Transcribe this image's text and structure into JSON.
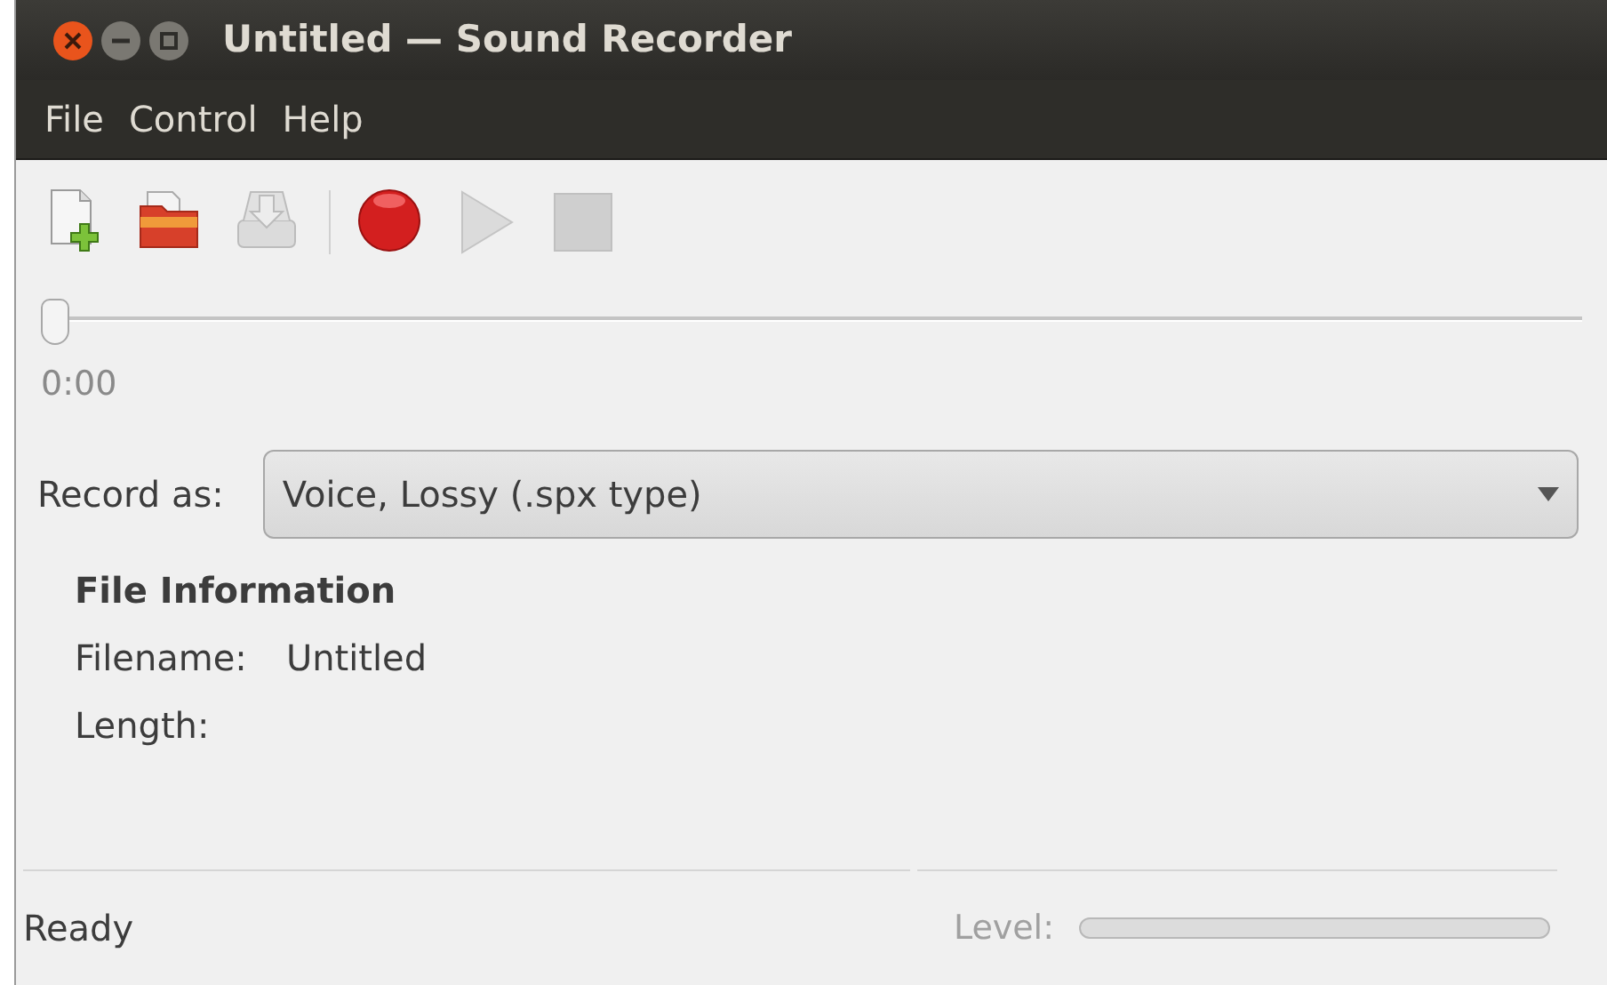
{
  "window": {
    "title": "Untitled — Sound Recorder"
  },
  "menu": [
    "File",
    "Control",
    "Help"
  ],
  "toolbar": [
    {
      "kind": "new",
      "disabled": false
    },
    {
      "kind": "open",
      "disabled": false
    },
    {
      "kind": "save",
      "disabled": true
    },
    {
      "kind": "separator"
    },
    {
      "kind": "record",
      "disabled": false
    },
    {
      "kind": "play",
      "disabled": true
    },
    {
      "kind": "stop",
      "disabled": true
    }
  ],
  "position": {
    "level": 0,
    "time": "0:00"
  },
  "record_as": {
    "label": "Record as:",
    "value": "Voice, Lossy (.spx type)"
  },
  "file_info": {
    "heading": "File Information",
    "rows": [
      {
        "label": "Filename:",
        "value": "Untitled"
      },
      {
        "label": "Length:",
        "value": ""
      }
    ]
  },
  "status_bar": {
    "text": "Ready",
    "level_label": "Level:",
    "level": 0
  }
}
